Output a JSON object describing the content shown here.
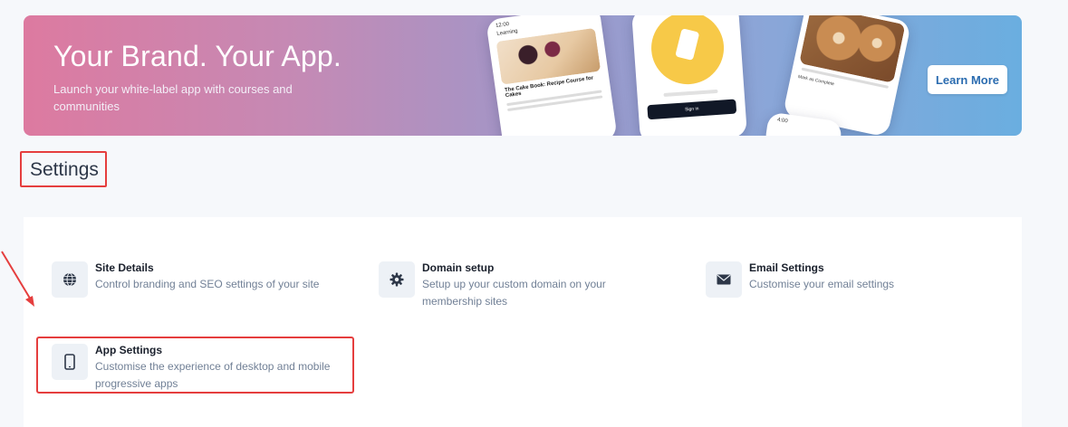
{
  "banner": {
    "title": "Your Brand. Your App.",
    "subtitle": "Launch your white-label app with courses and communities",
    "cta_label": "Learn More",
    "phones": {
      "phone1_status": "12:00",
      "phone1_header": "Learning",
      "phone1_caption": "The Cake Book: Recipe Course for Cakes",
      "phone2_button": "Sign in",
      "phone3_caption": "Mark as Complete",
      "phone4_status": "4:00"
    }
  },
  "page": {
    "title": "Settings"
  },
  "settings": {
    "items": [
      {
        "title": "Site Details",
        "description": "Control branding and SEO settings of your site",
        "icon": "globe-icon"
      },
      {
        "title": "Domain setup",
        "description": "Setup up your custom domain on your membership sites",
        "icon": "gear-icon"
      },
      {
        "title": "Email Settings",
        "description": "Customise your email settings",
        "icon": "envelope-icon"
      },
      {
        "title": "App Settings",
        "description": "Customise the experience of desktop and mobile progressive apps",
        "icon": "mobile-phone-icon"
      }
    ]
  },
  "colors": {
    "highlight": "#e53e3e",
    "link": "#2b6cb0",
    "icon_bg": "#edf1f6"
  }
}
